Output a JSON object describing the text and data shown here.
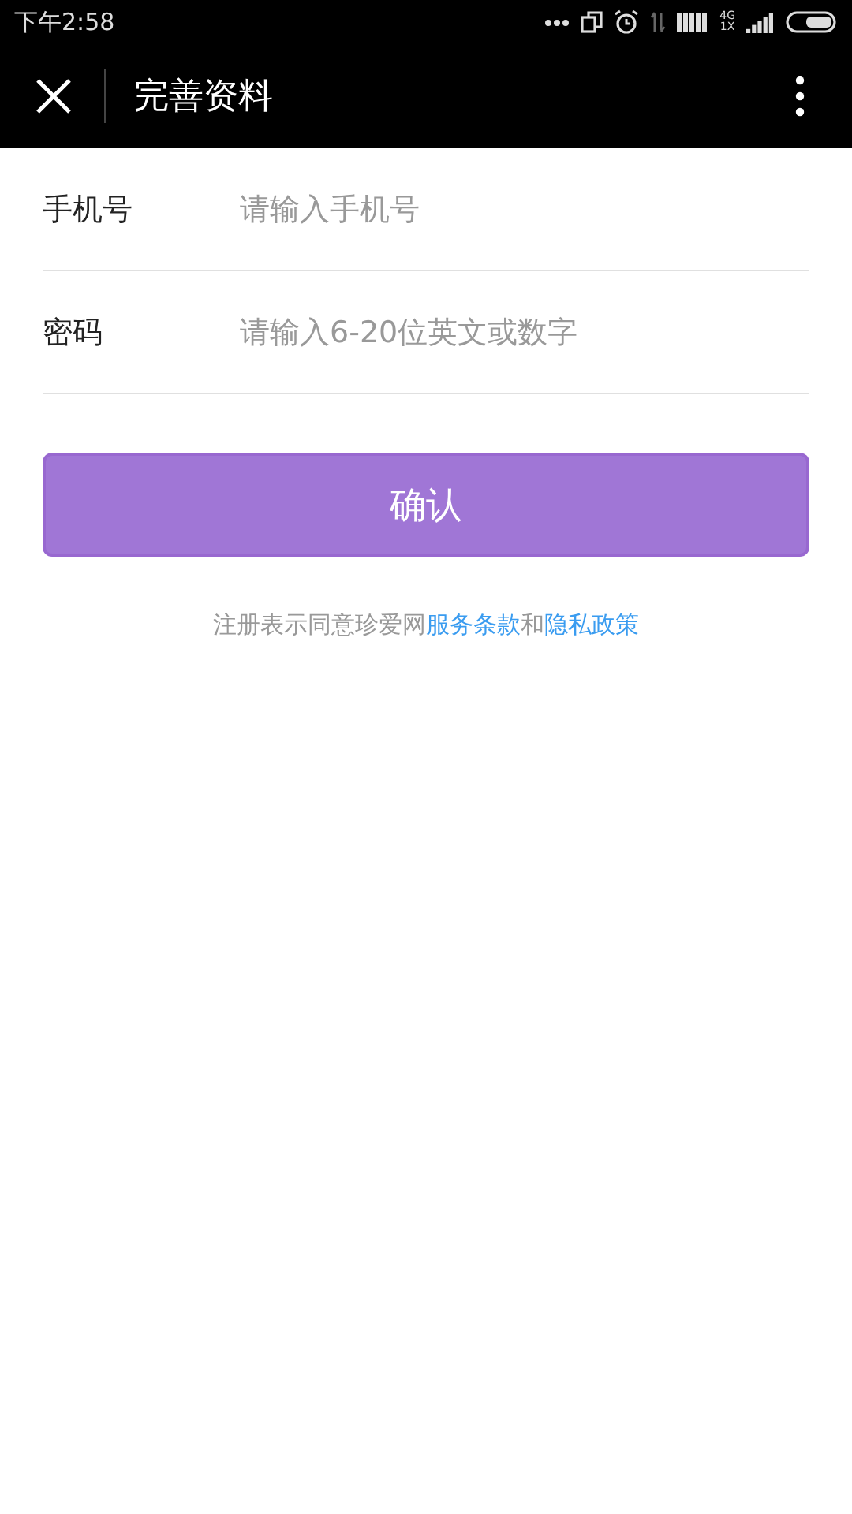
{
  "status_bar": {
    "time": "下午2:58",
    "network_label": "4G\n1X"
  },
  "nav_bar": {
    "title": "完善资料"
  },
  "fields": [
    {
      "label": "手机号",
      "placeholder": "请输入手机号"
    },
    {
      "label": "密码",
      "placeholder": "请输入6-20位英文或数字"
    }
  ],
  "confirm_button": {
    "label": "确认"
  },
  "agreement": [
    {
      "text": "注册表示同意珍爱网",
      "kind": "text"
    },
    {
      "text": "服务条款",
      "kind": "link"
    },
    {
      "text": "和",
      "kind": "text"
    },
    {
      "text": "隐私政策",
      "kind": "link"
    }
  ]
}
